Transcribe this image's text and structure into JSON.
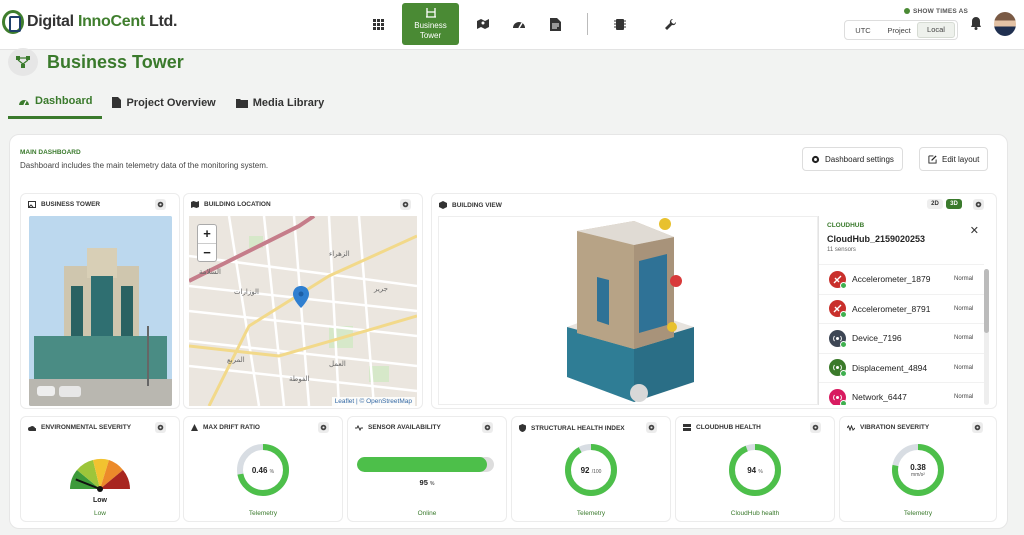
{
  "app": {
    "logo": {
      "prefix": "Digital ",
      "accent": "InnoCent",
      "suffix": " Ltd."
    },
    "nav": {
      "active_label_1": "Business",
      "active_label_2": "Tower"
    },
    "show_times_label": "SHOW TIMES AS",
    "timezones": [
      "UTC",
      "Project",
      "Local"
    ],
    "timezone_selected": "Local"
  },
  "project": {
    "title": "Business Tower",
    "tabs": [
      {
        "label": "Dashboard",
        "active": true
      },
      {
        "label": "Project Overview",
        "active": false
      },
      {
        "label": "Media Library",
        "active": false
      }
    ]
  },
  "dashboard": {
    "title": "MAIN DASHBOARD",
    "description": "Dashboard includes the main telemetry data of the monitoring system.",
    "settings_button": "Dashboard settings",
    "edit_button": "Edit layout"
  },
  "widgets": {
    "tower": {
      "title": "BUSINESS TOWER"
    },
    "location": {
      "title": "BUILDING LOCATION",
      "zoom_in": "+",
      "zoom_out": "−",
      "attribution": "Leaflet | © OpenStreetMap"
    },
    "view": {
      "title": "BUILDING VIEW",
      "mode_2d": "2D",
      "mode_3d": "3D",
      "active_mode": "3D"
    },
    "cloudhub": {
      "kicker": "CLOUDHUB",
      "name": "CloudHub_2159020253",
      "count": "11 sensors",
      "sensors": [
        {
          "name": "Accelerometer_1879",
          "status": "Normal",
          "color": "#c9302c",
          "icon": "accelerometer-icon"
        },
        {
          "name": "Accelerometer_8791",
          "status": "Normal",
          "color": "#c9302c",
          "icon": "accelerometer-icon"
        },
        {
          "name": "Device_7196",
          "status": "Normal",
          "color": "#3d4654",
          "icon": "device-icon"
        },
        {
          "name": "Displacement_4894",
          "status": "Normal",
          "color": "#3b7a2a",
          "icon": "displacement-icon"
        },
        {
          "name": "Network_6447",
          "status": "Normal",
          "color": "#d81b60",
          "icon": "network-icon"
        }
      ]
    }
  },
  "metrics": {
    "environmental": {
      "title": "ENVIRONMENTAL SEVERITY",
      "value": "Low",
      "footer": "Low",
      "level": 0.12
    },
    "drift": {
      "title": "MAX DRIFT RATIO",
      "value": "0.46",
      "unit": "%",
      "footer": "Telemetry",
      "fraction": 0.72
    },
    "availability": {
      "title": "SENSOR AVAILABILITY",
      "value": "95",
      "unit": "%",
      "footer": "Online",
      "fraction": 0.95
    },
    "structural": {
      "title": "STRUCTURAL HEALTH INDEX",
      "value": "92",
      "unit": "/100",
      "footer": "Telemetry",
      "fraction": 0.92
    },
    "cloudhub_health": {
      "title": "CLOUDHUB HEALTH",
      "value": "94",
      "unit": "%",
      "footer": "CloudHub health",
      "fraction": 0.94
    },
    "vibration": {
      "title": "VIBRATION SEVERITY",
      "value": "0.38",
      "unit": "mm/s²",
      "footer": "Telemetry",
      "fraction": 0.78
    }
  },
  "colors": {
    "brand": "#3a7a2c",
    "ring": "#4dbf4a",
    "ring_track": "#d8dde3"
  }
}
